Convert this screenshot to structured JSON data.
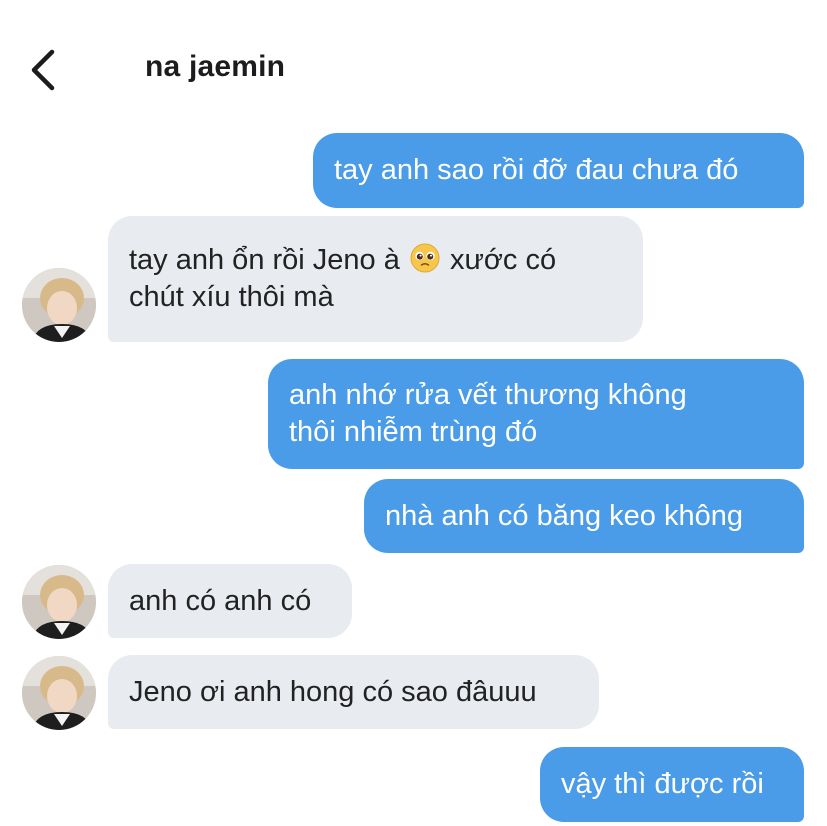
{
  "header": {
    "contact_name": "na jaemin"
  },
  "messages": [
    {
      "direction": "out",
      "lines": [
        "tay anh sao rồi đỡ đau chưa đó"
      ]
    },
    {
      "direction": "in",
      "lines": [
        "tay anh ổn rồi Jeno à",
        "xước có",
        "chút xíu thôi mà"
      ],
      "emoji": "pleading-face-emoji"
    },
    {
      "direction": "out",
      "lines": [
        "anh nhớ rửa vết thương không",
        "thôi nhiễm trùng đó"
      ]
    },
    {
      "direction": "out",
      "lines": [
        "nhà anh có băng keo không"
      ]
    },
    {
      "direction": "in",
      "lines": [
        "anh có anh có"
      ]
    },
    {
      "direction": "in",
      "lines": [
        "Jeno ơi anh hong có sao đâuuu"
      ]
    },
    {
      "direction": "out",
      "lines": [
        "vậy thì được rồi"
      ]
    }
  ],
  "colors": {
    "outgoing_bubble": "#4a9be8",
    "incoming_bubble": "#e8ebef",
    "outgoing_text": "#ffffff",
    "incoming_text": "#222222"
  },
  "icons": {
    "back": "chevron-left-icon",
    "avatar": "contact-avatar",
    "emoji": "pleading-face-emoji"
  }
}
